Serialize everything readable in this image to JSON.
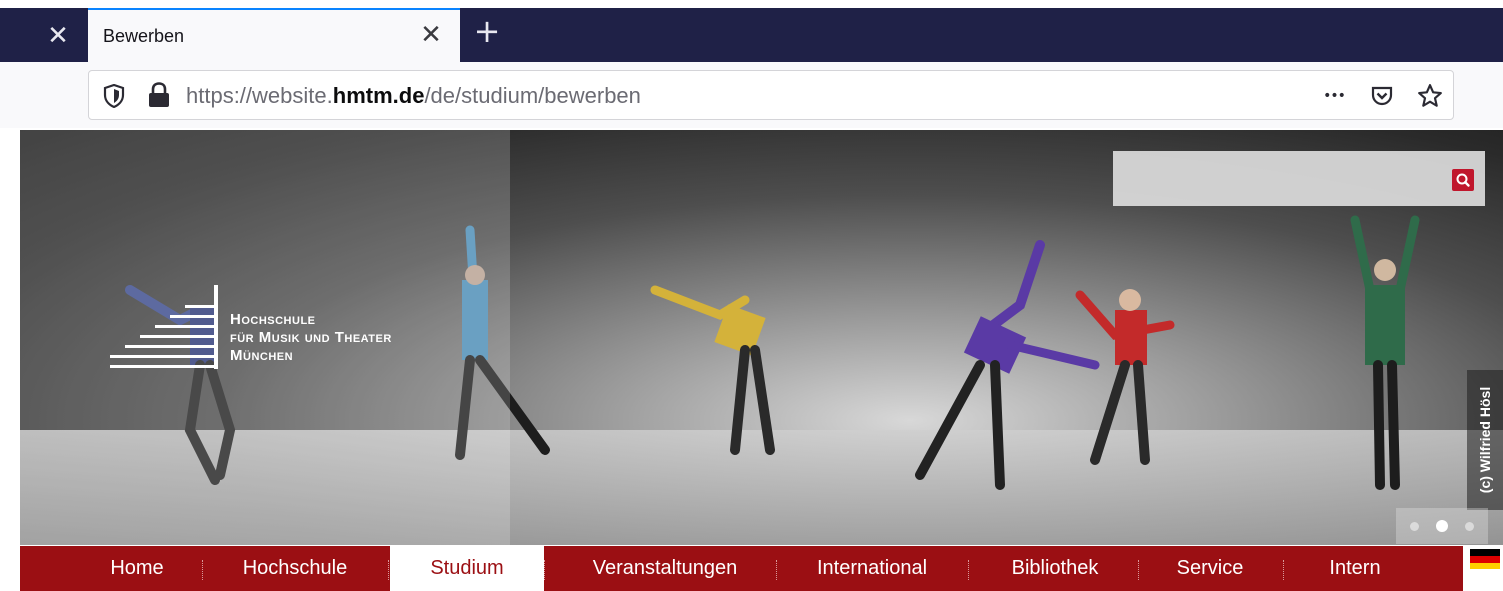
{
  "browser": {
    "tab_title": "Bewerben",
    "url_prefix": "https://website.",
    "url_domain": "hmtm.de",
    "url_path": "/de/studium/bewerben",
    "close_window_glyph": "✕",
    "tab_close_glyph": "✕",
    "new_tab_glyph": "+",
    "more_glyph": "•••",
    "accent": "#0a84ff",
    "tabbar_color": "#1f2147"
  },
  "hero": {
    "logo_line1": "Hochschule",
    "logo_line2": "für Musik und Theater",
    "logo_line3": "München",
    "photo_credit": "(c) Wilfried Hösl",
    "slides": 3,
    "active_slide": 2
  },
  "search": {
    "placeholder": "",
    "icon": "search-icon",
    "button_color": "#c0162c"
  },
  "nav": {
    "items": [
      {
        "label": "Home"
      },
      {
        "label": "Hochschule"
      },
      {
        "label": "Studium"
      },
      {
        "label": "Veranstaltungen"
      },
      {
        "label": "International"
      },
      {
        "label": "Bibliothek"
      },
      {
        "label": "Service"
      },
      {
        "label": "Intern"
      }
    ],
    "active_index": 2,
    "bar_color": "#9b0f13"
  },
  "language": {
    "flag": "german-flag-icon"
  }
}
